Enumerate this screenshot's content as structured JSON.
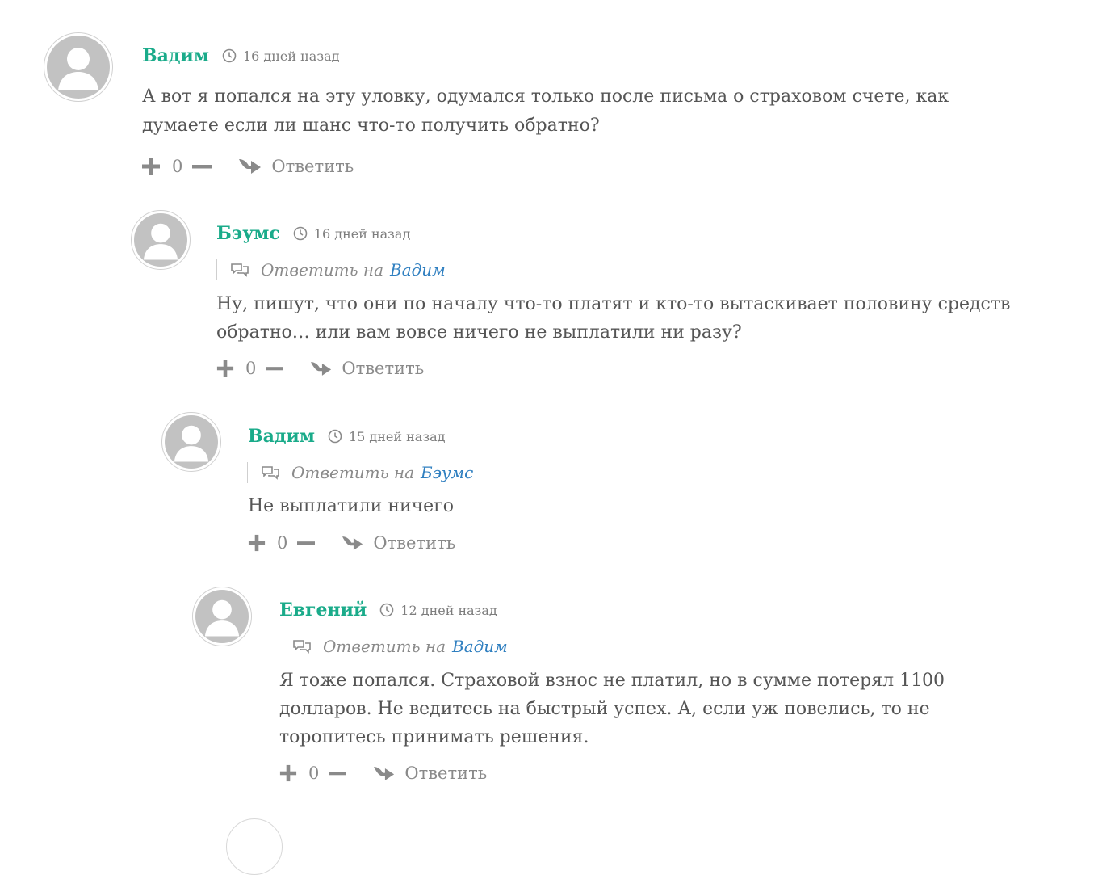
{
  "comments": [
    {
      "author": "Вадим",
      "time": "16 дней назад",
      "reply_prefix": "",
      "reply_target": "",
      "lines": [
        "А вот я попался на эту уловку, одумался только после письма о страховом счете, как",
        "думаете если ли шанс что-то получить обратно?"
      ],
      "votes": "0",
      "reply_label": "Ответить"
    },
    {
      "author": "Бэумс",
      "time": "16 дней назад",
      "reply_prefix": "Ответить на",
      "reply_target": "Вадим",
      "lines": [
        "Ну, пишут, что они по началу что-то платят и кто-то вытаскивает половину средств",
        "обратно… или вам вовсе ничего не выплатили ни разу?"
      ],
      "votes": "0",
      "reply_label": "Ответить"
    },
    {
      "author": "Вадим",
      "time": "15 дней назад",
      "reply_prefix": "Ответить на",
      "reply_target": "Бэумс",
      "lines": [
        "Не выплатили ничего"
      ],
      "votes": "0",
      "reply_label": "Ответить"
    },
    {
      "author": "Евгений",
      "time": "12 дней назад",
      "reply_prefix": "Ответить на",
      "reply_target": "Вадим",
      "lines": [
        "Я тоже попался. Страховой взнос не платил, но в сумме потерял 1100",
        "долларов. Не ведитесь на быстрый успех. А, если уж повелись, то не",
        "торопитесь принимать решения."
      ],
      "votes": "0",
      "reply_label": "Ответить"
    }
  ],
  "colors": {
    "author": "#1aab8a",
    "link": "#2f7fc0",
    "text": "#555555",
    "muted": "#8a8a8a"
  },
  "icons": {
    "time": "clock-icon",
    "reply_to": "speech-bubbles-icon",
    "vote_up": "plus-icon",
    "vote_down": "minus-icon",
    "reply": "reply-arrow-icon",
    "avatar": "default-user-avatar"
  }
}
